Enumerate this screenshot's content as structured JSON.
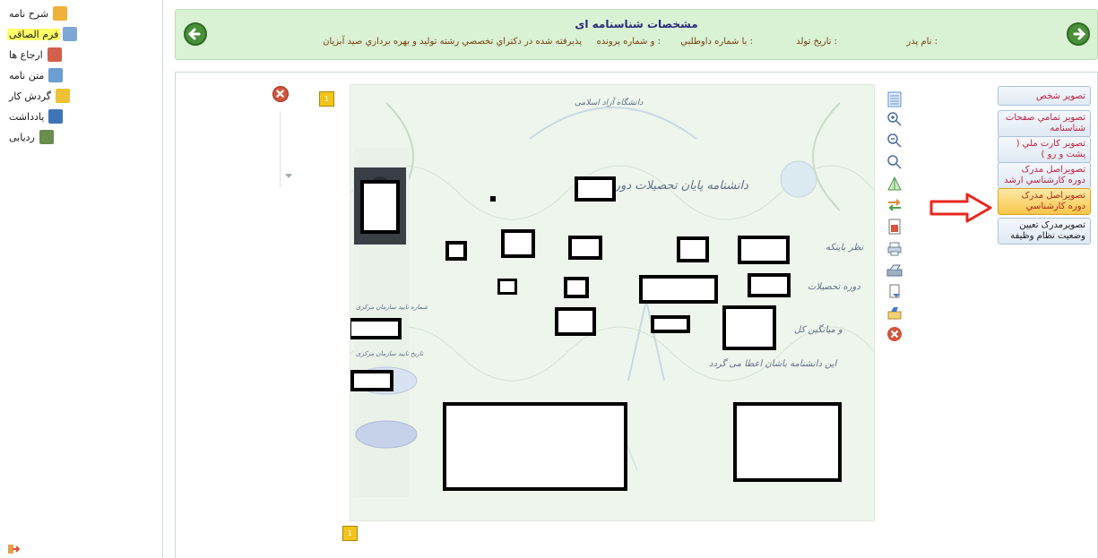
{
  "sidebar": {
    "items": [
      {
        "label": "شرح نامه",
        "icon": "pencil-note-icon",
        "color": "#f0b13a",
        "active": false
      },
      {
        "label": "فرم الصاقی",
        "icon": "form-icon",
        "color": "#7da7d6",
        "active": true
      },
      {
        "label": "ارجاع ها",
        "icon": "referral-icon",
        "color": "#d45f4c",
        "active": false
      },
      {
        "label": "متن نامه",
        "icon": "letter-text-icon",
        "color": "#6b9ed1",
        "active": false
      },
      {
        "label": "گردش کار",
        "icon": "workflow-icon",
        "color": "#efc136",
        "active": false
      },
      {
        "label": "یادداشت",
        "icon": "notebook-icon",
        "color": "#3e74b8",
        "active": false
      },
      {
        "label": "ردیابی",
        "icon": "tracking-icon",
        "color": "#6a8d4e",
        "active": false
      }
    ]
  },
  "header": {
    "title": "مشخصات شناسنامه ای",
    "father_name": "نام پدر :",
    "birth_date": "تاريخ تولد :",
    "applicant_no": "با شماره داوطلبي :",
    "file_no": "و شماره پرونده :",
    "accepted": "پذيرفته شده در دکتراي تخصصي رشته توليد و بهره برداري صيد آبزيان"
  },
  "tabs": [
    {
      "label": "تصوير شخص",
      "active": false
    },
    {
      "label": "تصوير تمامي صفحات شناسنامه",
      "active": false
    },
    {
      "label": "تصوير کارت ملي ( پشت و رو )",
      "active": false
    },
    {
      "label": "تصويراصل مدرک دوره کارشناسي ارشد",
      "active": false
    },
    {
      "label": "تصويراصل مدرک دوره کارشناسي",
      "active": true
    },
    {
      "label": "تصويرمدرک تعيين وضعيت نظام وظيفه",
      "active": false
    }
  ],
  "toolbar": [
    {
      "icon": "list-view-icon",
      "color": "#5b8ed0"
    },
    {
      "icon": "zoom-in-icon",
      "color": "#4a6fa0"
    },
    {
      "icon": "zoom-out-icon",
      "color": "#4a6fa0"
    },
    {
      "icon": "zoom-reset-icon",
      "color": "#4a6fa0"
    },
    {
      "icon": "flip-icon",
      "color": "#4f9d4a"
    },
    {
      "icon": "swap-icon",
      "color": "#e08b3a"
    },
    {
      "icon": "image-file-icon",
      "color": "#d9533e"
    },
    {
      "icon": "print-icon",
      "color": "#6a7f95"
    },
    {
      "icon": "scan-icon",
      "color": "#5f7590"
    },
    {
      "icon": "save-icon",
      "color": "#4a7fc1"
    },
    {
      "icon": "export-icon",
      "color": "#3f7ad0"
    },
    {
      "icon": "close-icon",
      "color": "#d2553d"
    }
  ],
  "document": {
    "header_line": "دانشگاه آزاد اسلامی",
    "title": "دانشنامه پایان تحصیلات دوره",
    "line1": "نظر باینکه",
    "line2": "دوره تحصیلات",
    "line3": "و میانگین کل",
    "line4": "این دانشنامه باشان اعطا می گردد",
    "seal_label_1": "شماره تایید سازمان مرکزی",
    "seal_label_2": "تاریخ تایید سازمان مرکزی"
  },
  "page_marker_top": "1",
  "page_marker_bottom": "1",
  "colors": {
    "header_bg": "#d8f2d3",
    "nav_button": "#4a8f3a",
    "tab_active": "#f8c64a",
    "arrow": "#e8261f",
    "active_item": "#ffff66"
  }
}
